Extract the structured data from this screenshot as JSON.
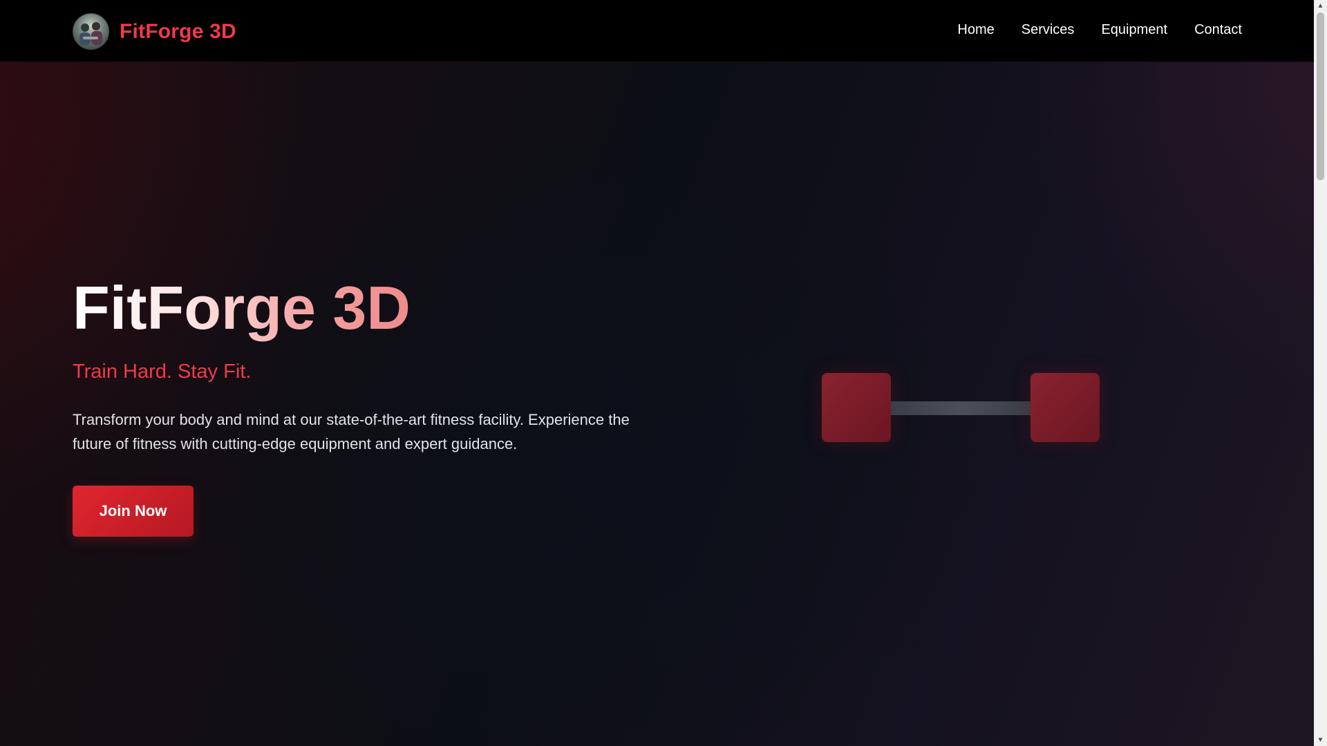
{
  "header": {
    "brand_name": "FitForge 3D",
    "nav": [
      {
        "label": "Home"
      },
      {
        "label": "Services"
      },
      {
        "label": "Equipment"
      },
      {
        "label": "Contact"
      }
    ]
  },
  "hero": {
    "title": "FitForge 3D",
    "tagline": "Train Hard. Stay Fit.",
    "description": "Transform your body and mind at our state-of-the-art fitness facility. Experience the future of fitness with cutting-edge equipment and expert guidance.",
    "cta_label": "Join Now"
  },
  "icons": {
    "logo": "gym-logo-photo",
    "hero_graphic": "dumbbell-icon",
    "scroll_up": "arrow-up-icon",
    "scroll_down": "arrow-down-icon"
  },
  "colors": {
    "accent": "#ef3b47",
    "cta_bg": "#d1202b",
    "header_bg": "#000000",
    "plate": "#7a1d29"
  }
}
